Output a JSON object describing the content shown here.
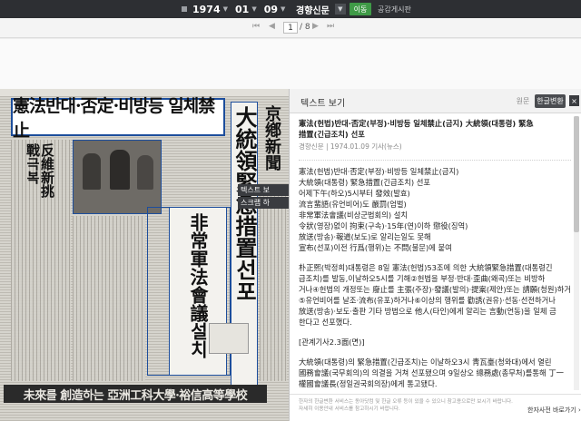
{
  "topbar": {
    "year": "1974",
    "month": "01",
    "day": "09",
    "paper": "경향신문",
    "go_label": "이동",
    "share_label": "공감게시판"
  },
  "pager": {
    "first": "⏮",
    "prev": "◀",
    "current": "1",
    "total": "/ 8",
    "next": "▶",
    "last": "⏭"
  },
  "newspaper": {
    "headline": "憲法반대·否定·비방등 일체禁止",
    "right_vertical": "大統領緊急措置선포",
    "masthead": "京鄕新聞",
    "left_column": "反維新挑戰극복",
    "mid_column": "非常軍法會議설치",
    "bottom_banner": "未來를 創造하는 亞洲工科大學·裕信高等學校",
    "tabs": [
      "텍스트 보",
      "스크랩 하"
    ]
  },
  "reader": {
    "title": "텍스트 보기",
    "original_label": "원문",
    "hangul_label": "한글변환",
    "close_label": "×",
    "article_title_1": "憲法(헌법)반대·否定(부정)·비방등 일체禁止(금지) 大統領(대통령) 緊急",
    "article_title_2": "措置(긴급조치) 선포",
    "meta": "경향신문 | 1974.01.09 기사(뉴스)",
    "lines": [
      "憲法(헌법)반대·否定(부정)·비방등 일체禁止(금지)",
      "大統領(대통령) 緊急措置(긴급조치) 선포",
      "어제下午(하오)5시부터 發效(발효)",
      "流言蜚語(유언비어)도 嚴罰(엄벌)",
      "非常軍法會議(비상군법회의) 설치",
      "令狀(영장)없이 拘束(구속)·15年(연)이하 懲役(징역)",
      "放送(방송)·報道(보도)로 알리는일도 못해",
      "宣布(선포)이전 行爲(행위)는 不問(불문)에 붙여"
    ],
    "para1": [
      "朴正熙(박정희)대통령은 8일 憲法(헌법)53조에 의한 大統領緊急措置(대통령긴",
      "급조치)를 발동,이날하오5시를 기해②헌법을 부정·반대·歪曲(왜곡)또는 비방하",
      "거나④헌법의 개정또는 廢止를 主張(주장)·發議(발의)·提案(제안)또는 請願(청원)하거나",
      "⑤유언비어를 날조·流布(유포)하거나⑥이상의 행위를 勸誘(권유)·선동·선전하거나",
      "放送(방송)·보도·출판 기타 방법으로 他人(타인)에게 알리는 言動(언동)을 일체 금",
      "한다고 선포했다."
    ],
    "section": "[관계기사2.3面(면)]",
    "para2": [
      "大統領(대통령)의 緊急措置(긴급조치)는 이날하오3시 靑瓦臺(청와대)에서 열린",
      "國務會議(국무회의)의 의결을 거쳐 선포됐으며 9일상오 總務處(총무처)를통해 丁一",
      "權國會議長(정일권국회의장)에게 통고됐다."
    ],
    "footnote_1": "한자의 한글변환 서비스는 동아닷컴 및 한글 오류 등이 있을 수 있으니 참고용으로만 보시기 바랍니다.",
    "footnote_2": "자세히 이용안내 서비스를 참고하시기 바랍니다.",
    "footer_button": "한자사전 바로가기 ›"
  }
}
